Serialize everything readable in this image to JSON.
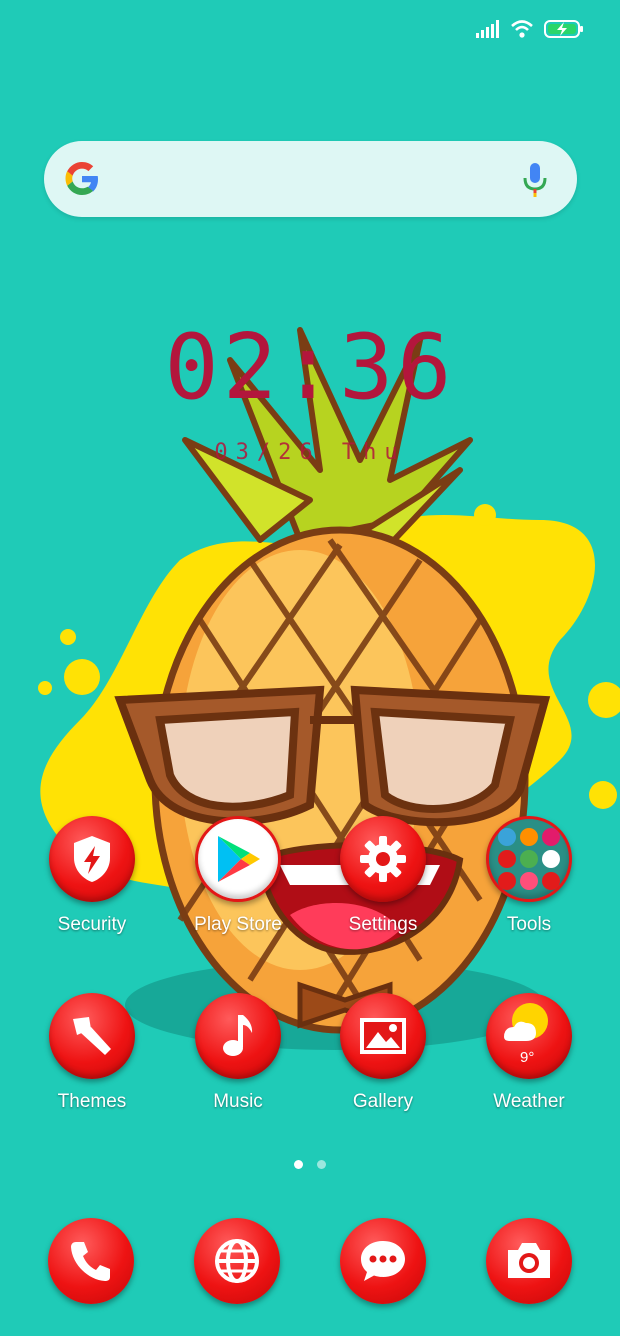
{
  "search": {
    "placeholder": "",
    "logo_icon": "google-g-icon",
    "mic_icon": "microphone-icon"
  },
  "clock": {
    "time": "02:36",
    "date": "03/26 Thu"
  },
  "apps": [
    {
      "label": "Security",
      "icon": "shield-bolt-icon"
    },
    {
      "label": "Play Store",
      "icon": "play-store-icon"
    },
    {
      "label": "Settings",
      "icon": "gear-icon"
    },
    {
      "label": "Tools",
      "icon": "folder-icon"
    },
    {
      "label": "Themes",
      "icon": "paint-brush-icon"
    },
    {
      "label": "Music",
      "icon": "music-note-icon"
    },
    {
      "label": "Gallery",
      "icon": "image-icon"
    },
    {
      "label": "Weather",
      "icon": "sun-cloud-icon",
      "temperature": "9°"
    }
  ],
  "dock": [
    {
      "icon": "phone-icon"
    },
    {
      "icon": "globe-icon"
    },
    {
      "icon": "message-icon"
    },
    {
      "icon": "camera-icon"
    }
  ],
  "pager": {
    "pages": 2,
    "current": 1
  },
  "colors": {
    "background": "#1fcbb7",
    "icon_red": "#e31717",
    "clock": "#b3163c"
  }
}
